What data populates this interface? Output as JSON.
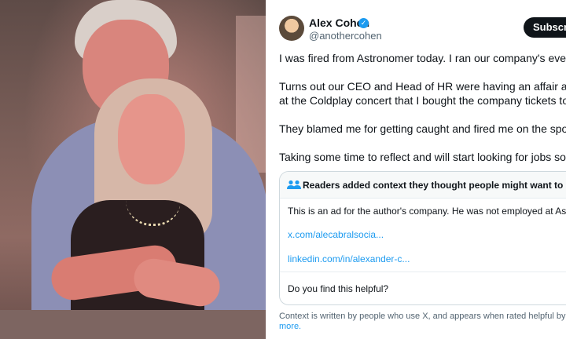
{
  "photo": {
    "alt_subject": "concert kiss-cam photo"
  },
  "author": {
    "name": "Alex Cohen",
    "handle": "@anothercohen",
    "subscribe_label": "Subscribe"
  },
  "tweet": {
    "paragraphs": [
      "I was fired from Astronomer today. I ran our company's events",
      "Turns out our CEO and Head of HR were having an affair and g",
      "at the Coldplay concert that I bought the company tickets to.",
      "They blamed me for getting caught and fired me on the spot.",
      "Taking some time to reflect and will start looking for jobs soor"
    ]
  },
  "community_note": {
    "title": "Readers added context they thought people might want to know",
    "body": "This is an ad for the author's company. He was not employed at Astr",
    "links": [
      "x.com/alecabralsocia...",
      "linkedin.com/in/alexander-c..."
    ],
    "helpful_prompt": "Do you find this helpful?"
  },
  "footer": {
    "text": "Context is written by people who use X, and appears when rated helpful by other",
    "more_label": "more."
  },
  "colors": {
    "accent": "#1d9bf0",
    "text": "#0f1419",
    "muted": "#536471"
  }
}
